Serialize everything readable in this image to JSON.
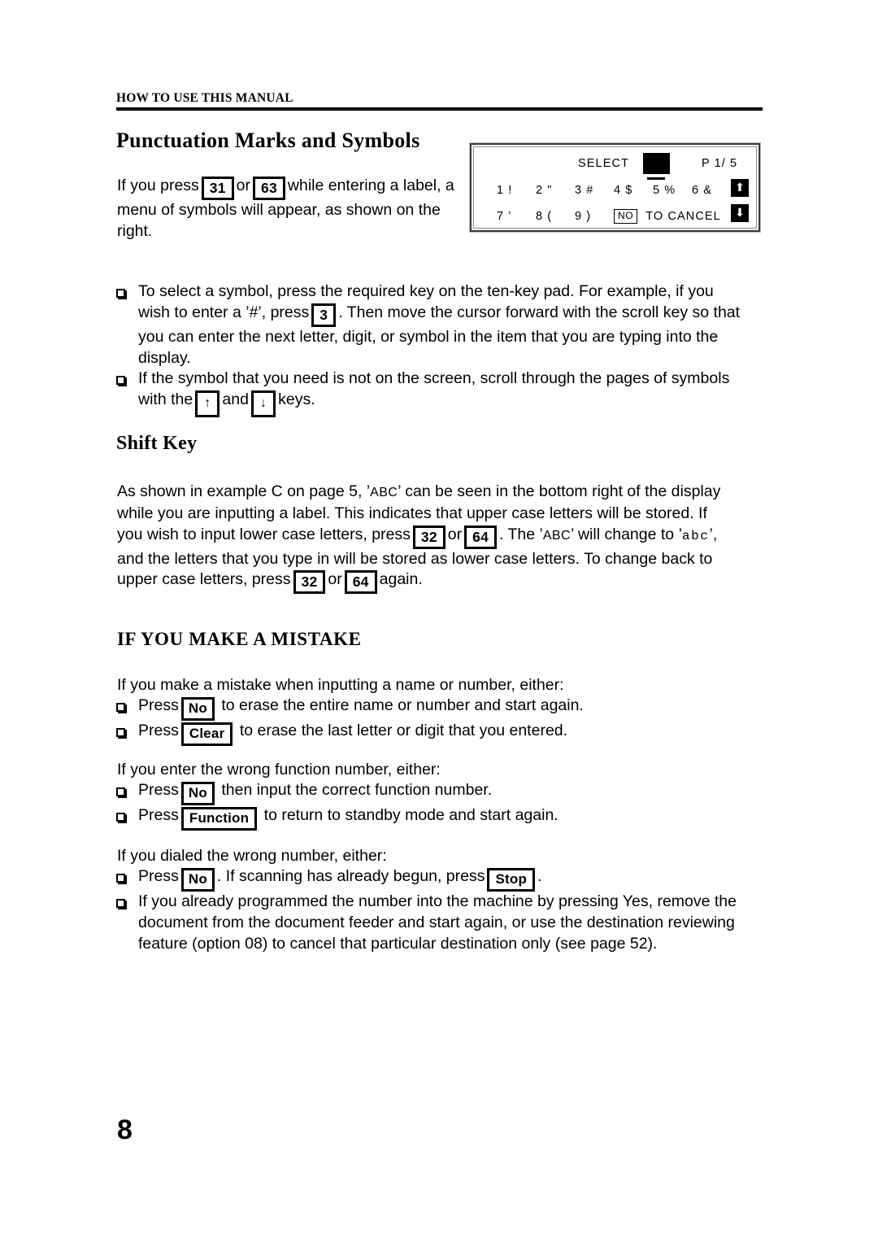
{
  "header": {
    "running_head": "HOW TO USE THIS MANUAL"
  },
  "sections": {
    "punctuation": {
      "heading": "Punctuation Marks and Symbols",
      "intro_part1": "If you press",
      "key_31": "31",
      "or": "or",
      "key_63": "63",
      "intro_part2": "while entering a label, a menu of symbols will appear, as shown on the right.",
      "bullets": [
        {
          "part1": "To select a symbol, press the required key on the ten-key pad. For example, if you wish to enter a ’#’, press",
          "key": "3",
          "part2": ". Then move the cursor forward with the scroll key so that you can enter the next letter, digit, or symbol in the item that you are typing into the display."
        },
        {
          "part1": "If the symbol that you need is not on the screen, scroll through the pages of symbols with the",
          "key_up": "↑",
          "mid": "and",
          "key_down": "↓",
          "part2": "keys."
        }
      ]
    },
    "shift": {
      "heading": "Shift Key",
      "p1": "As shown in example C on page",
      "page_ref": "5",
      "p2": ", ’",
      "abc_upper": "ABC",
      "p3": "’ can be seen in the bottom right of the display while you are inputting a label. This indicates that upper case letters will be stored. If you wish to input lower case letters, press",
      "key_32a": "32",
      "or_a": "or",
      "key_64a": "64",
      "p4": ". The ’",
      "abc_upper_2": "ABC",
      "p5": "’ will change to ’",
      "abc_lower": "abc",
      "p6": "’, and the letters that you type in will be stored as lower case letters. To change back to upper case letters, press",
      "key_32b": "32",
      "or_b": "or",
      "key_64b": "64",
      "p7": "again."
    },
    "mistake": {
      "heading": "IF YOU MAKE A MISTAKE",
      "intro_1": "If you make a mistake when inputting a name or number, either:",
      "group_1": [
        {
          "press": "Press",
          "key": "No",
          "tail": "to erase the entire name or number and start again."
        },
        {
          "press": "Press",
          "key": "Clear",
          "tail": "to erase the last letter or digit that you entered."
        }
      ],
      "intro_2": "If you enter the wrong function number, either:",
      "group_2": [
        {
          "press": "Press",
          "key": "No",
          "tail": "then input the correct function number."
        },
        {
          "press": "Press",
          "key": "Function",
          "tail": "to return to standby mode and start again."
        }
      ],
      "intro_3": "If you dialed the wrong number, either:",
      "group_3": [
        {
          "press": "Press",
          "key": "No",
          "mid": ". If scanning has already begun, press",
          "key2": "Stop",
          "tail": "."
        },
        {
          "text": "If you already programmed the number into the machine by pressing Yes, remove the document from the document feeder and start again, or use the destination reviewing feature (option 08) to cancel that particular destination only (see page  52)."
        }
      ]
    }
  },
  "lcd": {
    "select_label": "SELECT",
    "page_indicator": "P 1/ 5",
    "row1": [
      "1 !",
      "2 \"",
      "3 #",
      "4 $",
      "5 %",
      "6 &"
    ],
    "row2": [
      "7 ’",
      "8 (",
      "9 )"
    ],
    "no_key": "NO",
    "cancel_text": "TO CANCEL",
    "scroll_up": "⬆",
    "scroll_down": "⬇"
  },
  "folio": {
    "page_number": "8"
  }
}
